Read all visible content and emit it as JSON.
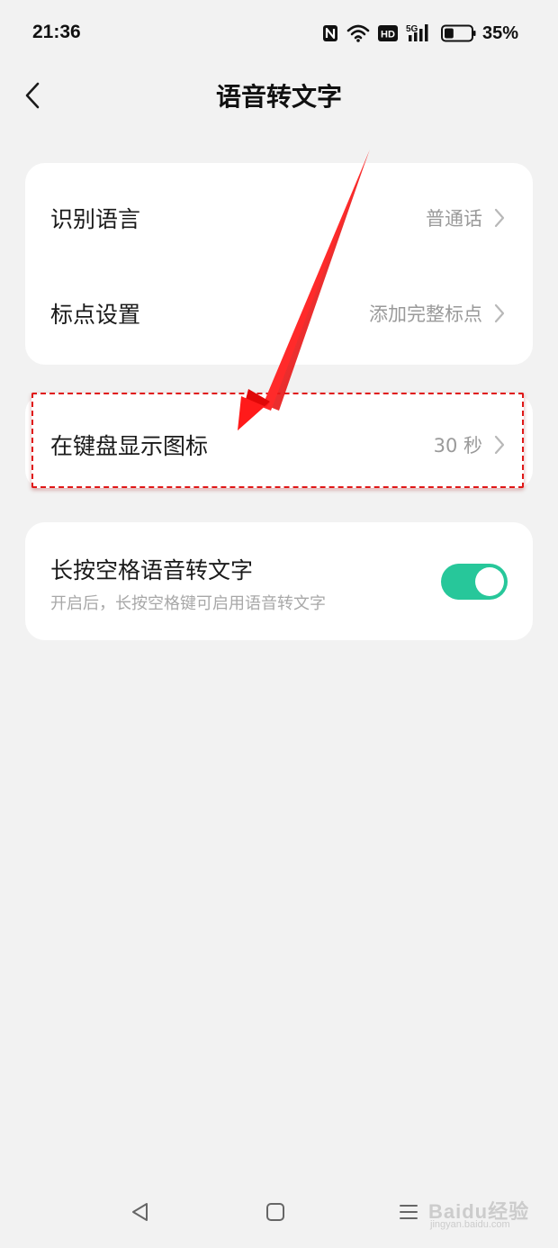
{
  "status_bar": {
    "time": "21:36",
    "icons": [
      "nfc-icon",
      "wifi-icon",
      "hd-icon",
      "5g-signal-icon",
      "battery-icon"
    ],
    "network_label": "5G",
    "hd_label": "HD",
    "battery_percent": "35%",
    "battery_level": 0.35
  },
  "header": {
    "title": "语音转文字",
    "back_icon": "chevron-left-icon"
  },
  "settings": {
    "recognition_language": {
      "label": "识别语言",
      "value": "普通话"
    },
    "punctuation": {
      "label": "标点设置",
      "value": "添加完整标点"
    },
    "keyboard_icon": {
      "label": "在键盘显示图标",
      "value": "30 秒"
    },
    "long_press_space": {
      "title": "长按空格语音转文字",
      "description": "开启后，长按空格键可启用语音转文字",
      "enabled": true
    }
  },
  "nav_bar": {
    "icons": [
      "nav-back-icon",
      "nav-home-icon",
      "nav-menu-icon"
    ]
  },
  "watermark": {
    "main": "Baidu经验",
    "sub": "jingyan.baidu.com"
  },
  "colors": {
    "background": "#f2f2f2",
    "card": "#ffffff",
    "accent_toggle": "#27c79a",
    "annotation_red": "#e01818",
    "secondary_text": "#9a9a9a"
  }
}
